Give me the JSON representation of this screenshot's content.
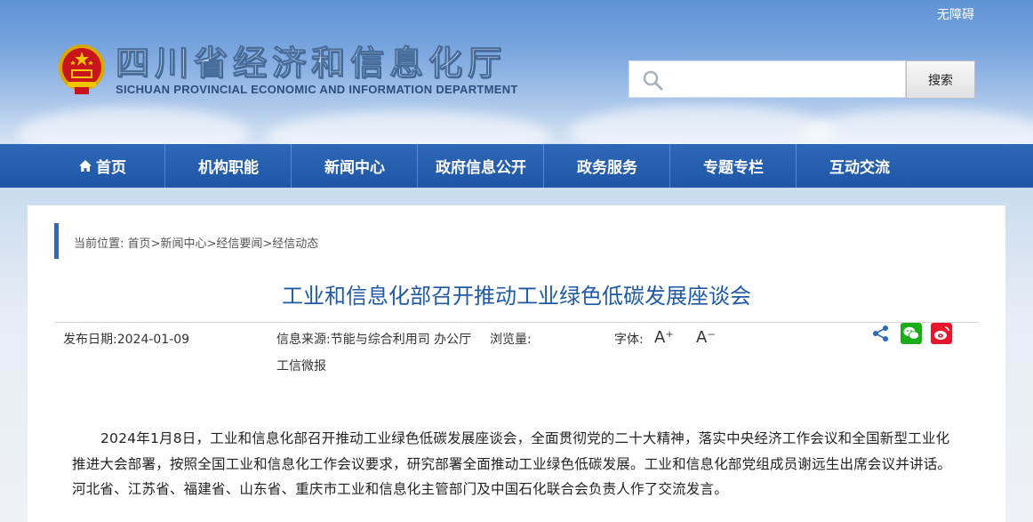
{
  "header": {
    "accessibility": "无障碍",
    "title_cn": "四川省经济和信息化厅",
    "title_en": "SICHUAN PROVINCIAL ECONOMIC AND INFORMATION DEPARTMENT",
    "search_placeholder": "",
    "search_button": "搜索"
  },
  "nav": {
    "items": [
      {
        "label": "首页",
        "icon": "home-icon"
      },
      {
        "label": "机构职能"
      },
      {
        "label": "新闻中心"
      },
      {
        "label": "政府信息公开"
      },
      {
        "label": "政务服务"
      },
      {
        "label": "专题专栏"
      },
      {
        "label": "互动交流"
      }
    ]
  },
  "breadcrumb": {
    "prefix": "当前位置:",
    "items": [
      "首页",
      "新闻中心",
      "经信要闻",
      "经信动态"
    ],
    "separator": ">"
  },
  "article": {
    "title": "工业和信息化部召开推动工业绿色低碳发展座谈会",
    "publish_date": "发布日期:2024-01-09",
    "source_label": "信息来源:",
    "source_value": "节能与综合利用司 办公厅",
    "source_value_2": "工信微报",
    "views_label": "浏览量:",
    "font_label": "字体:",
    "font_increase": "A⁺",
    "font_decrease": "A⁻",
    "body": "2024年1月8日，工业和信息化部召开推动工业绿色低碳发展座谈会，全面贯彻党的二十大精神，落实中央经济工作会议和全国新型工业化推进大会部署，按照全国工业和信息化工作会议要求，研究部署全面推动工业绿色低碳发展。工业和信息化部党组成员谢远生出席会议并讲话。河北省、江苏省、福建省、山东省、重庆市工业和信息化主管部门及中国石化联合会负责人作了交流发言。"
  },
  "share": {
    "icons": [
      "share-icon",
      "wechat-icon",
      "weibo-icon"
    ]
  },
  "colors": {
    "nav_bg": "#1f56a6",
    "title_blue": "#1f5aa2",
    "accent_bar": "#2d6ab7",
    "wechat_green": "#1aad19",
    "weibo_red": "#e6162d"
  }
}
